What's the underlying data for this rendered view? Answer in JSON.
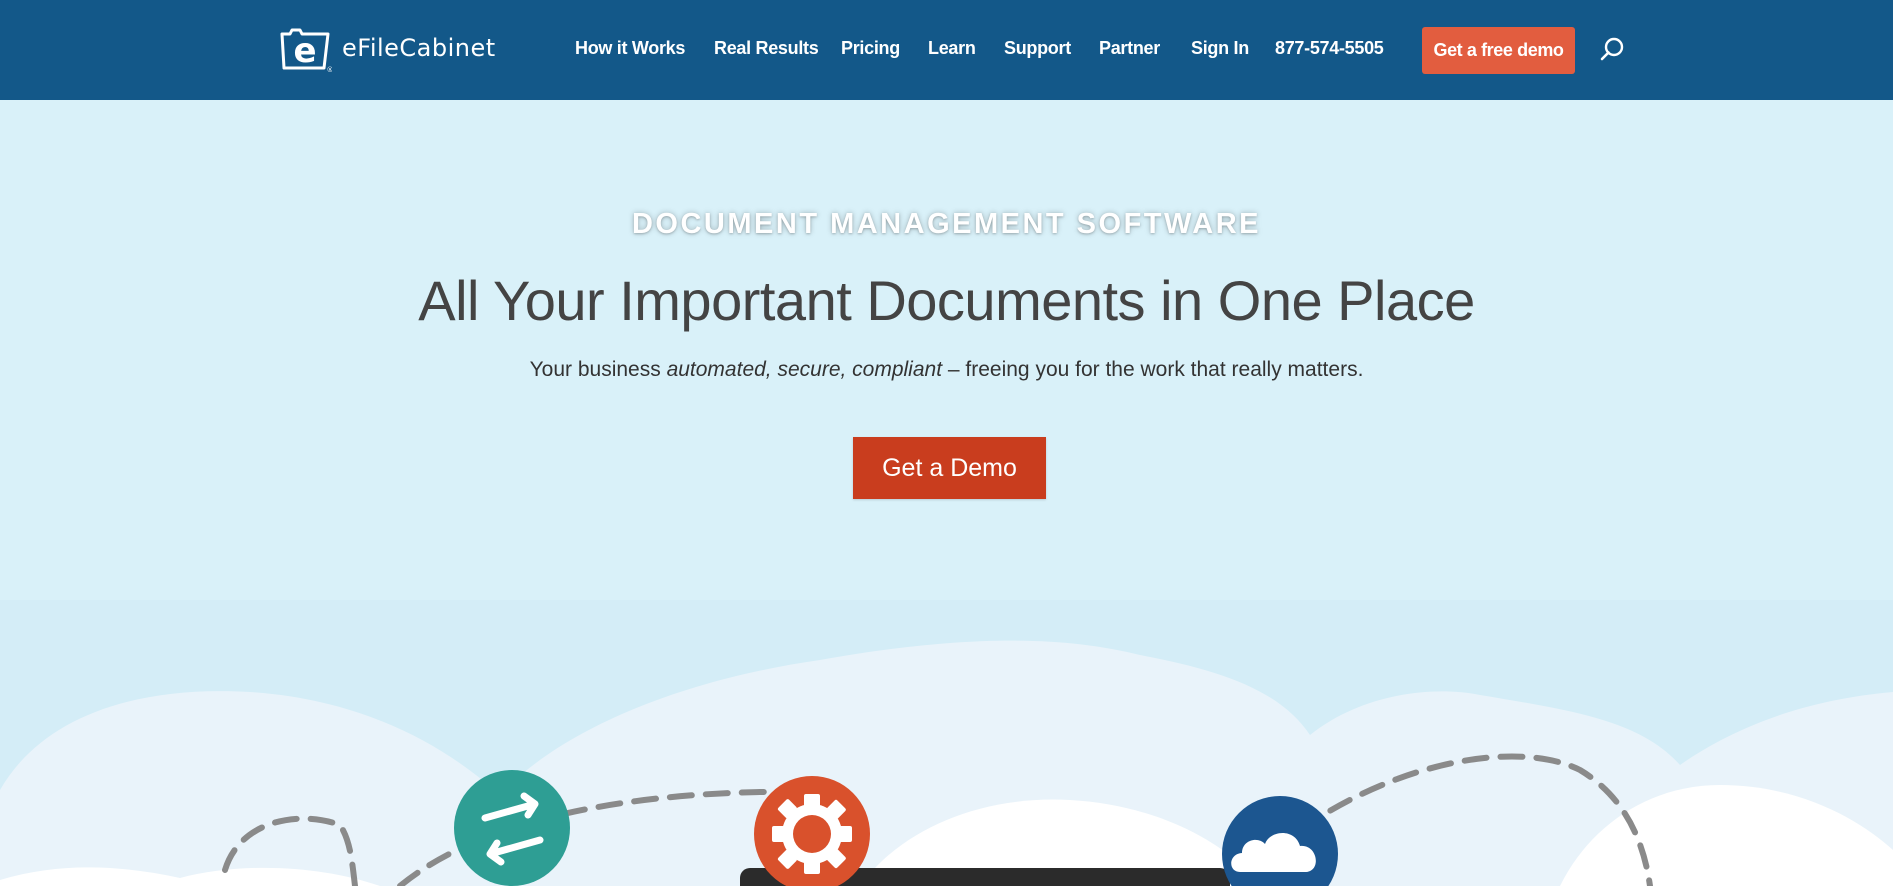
{
  "header": {
    "brand": "eFileCabinet",
    "nav": [
      {
        "label": "How it Works"
      },
      {
        "label": "Real Results"
      },
      {
        "label": "Pricing"
      },
      {
        "label": "Learn"
      },
      {
        "label": "Support"
      },
      {
        "label": "Partner"
      },
      {
        "label": "Sign In"
      },
      {
        "label": "877-574-5505"
      }
    ],
    "demo_button": "Get a free demo",
    "search_icon": "search-icon"
  },
  "hero": {
    "eyebrow": "DOCUMENT MANAGEMENT SOFTWARE",
    "title": "All Your Important Documents in One Place",
    "subtitle_prefix": "Your business ",
    "subtitle_emphasis": "automated, secure, compliant",
    "subtitle_suffix": " – freeing you for the work that really matters.",
    "cta": "Get a Demo"
  },
  "illustration": {
    "icons": [
      "sync-arrows-icon",
      "gear-icon",
      "cloud-icon"
    ]
  },
  "colors": {
    "header_bg": "#135889",
    "hero_bg": "#d9f1f9",
    "accent": "#e25d3f",
    "cta": "#c93d1e",
    "teal": "#2e9e94",
    "orange": "#d9512c",
    "navy": "#1c5690"
  }
}
